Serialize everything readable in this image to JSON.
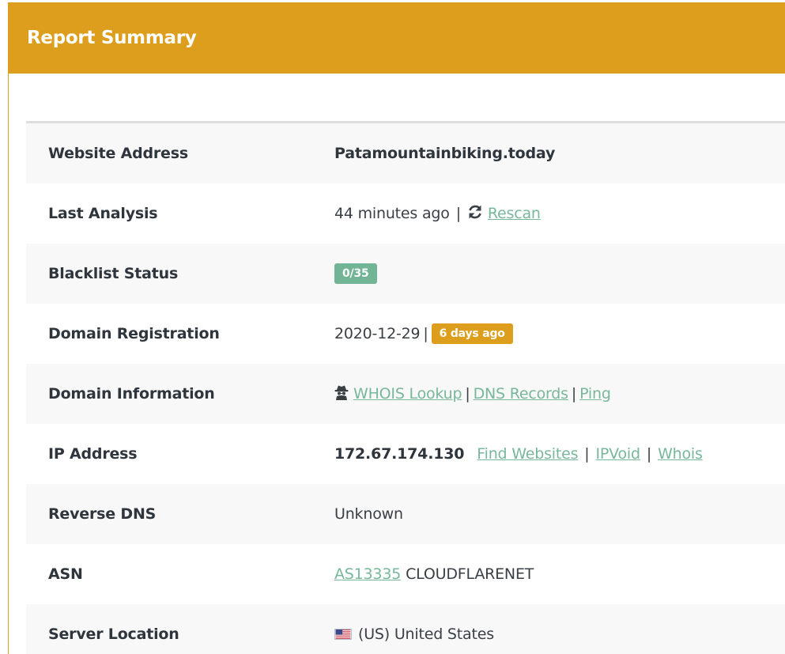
{
  "panel": {
    "title": "Report Summary"
  },
  "rows": {
    "website": {
      "label": "Website Address",
      "value": "Patamountainbiking.today"
    },
    "last_analysis": {
      "label": "Last Analysis",
      "value": "44 minutes ago",
      "separator": "|",
      "rescan_label": "Rescan",
      "rescan_icon": "refresh-icon"
    },
    "blacklist": {
      "label": "Blacklist Status",
      "badge": "0/35",
      "badge_color": "#72b496"
    },
    "registration": {
      "label": "Domain Registration",
      "date": "2020-12-29",
      "separator": "|",
      "badge": "6 days ago",
      "badge_color": "#dc9e1c"
    },
    "domain_info": {
      "label": "Domain Information",
      "icon": "spy-icon",
      "links": [
        "WHOIS Lookup",
        "DNS Records",
        "Ping"
      ],
      "separator": "|"
    },
    "ip": {
      "label": "IP Address",
      "value": "172.67.174.130",
      "links": [
        "Find Websites",
        "IPVoid",
        "Whois"
      ],
      "separator": "|"
    },
    "reverse_dns": {
      "label": "Reverse DNS",
      "value": "Unknown"
    },
    "asn": {
      "label": "ASN",
      "asn_link": "AS13335",
      "asn_name": "CLOUDFLARENET"
    },
    "server_location": {
      "label": "Server Location",
      "flag_icon": "us-flag-icon",
      "value": "(US) United States"
    }
  },
  "colors": {
    "accent": "#dc9e1c",
    "link": "#78b79a",
    "success": "#72b496"
  }
}
